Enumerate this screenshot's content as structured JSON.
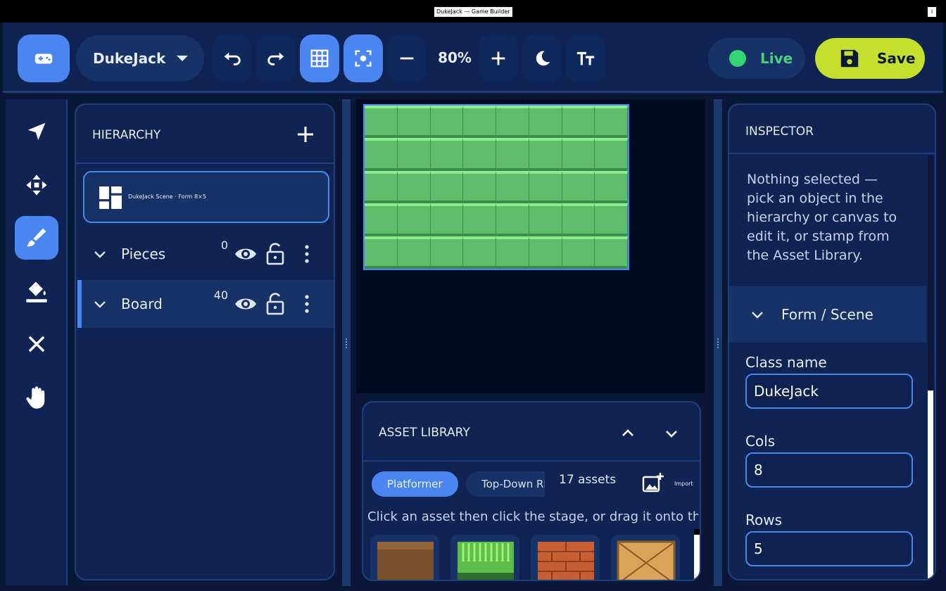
{
  "window": {
    "title": "DukeJack — Game Builder",
    "info": "i"
  },
  "topbar": {
    "project": "DukeJack",
    "zoom": "80%",
    "live_label": "Live",
    "save_label": "Save",
    "tools": [
      "gamepad-icon",
      "undo-icon",
      "redo-icon",
      "grid-icon",
      "focus-icon",
      "zoom-out-icon",
      "zoom-in-icon",
      "moon-icon",
      "text-size-icon"
    ]
  },
  "toolstrip": {
    "tools": [
      "pointer-icon",
      "move-icon",
      "brush-icon",
      "fill-icon",
      "erase-icon",
      "hand-icon"
    ],
    "active": "brush-icon"
  },
  "hierarchy": {
    "title": "HIERARCHY",
    "scene_label": "DukeJack Scene · Form 8×5",
    "layers": [
      {
        "name": "Pieces",
        "count": "0"
      },
      {
        "name": "Board",
        "count": "40"
      }
    ]
  },
  "canvas": {
    "cols": 8,
    "rows": 5
  },
  "assets": {
    "title": "ASSET LIBRARY",
    "tabs": [
      "Platformer",
      "Top-Down RPG"
    ],
    "count": "17 assets",
    "import_label": "Import",
    "hint": "Click an asset then click the stage, or drag it onto the stage",
    "tiles": [
      "dirt-tile",
      "grass-tile",
      "brick-tile",
      "crate-tile"
    ],
    "colors": {
      "dirt": "#7a4f2c",
      "grass": "#5dbd4a",
      "brick": "#c85f34",
      "crate": "#d9a35a"
    }
  },
  "inspector": {
    "title": "INSPECTOR",
    "message": "Nothing selected — pick an object in the hierarchy or canvas to edit it, or stamp from the Asset Library.",
    "section": "Form / Scene",
    "fields": [
      {
        "label": "Class name",
        "value": "DukeJack"
      },
      {
        "label": "Cols",
        "value": "8"
      },
      {
        "label": "Rows",
        "value": "5"
      }
    ]
  },
  "colors": {
    "accent": "#4a86f2",
    "save": "#c5e02c",
    "live": "#34d472",
    "panel": "#0f2452"
  }
}
